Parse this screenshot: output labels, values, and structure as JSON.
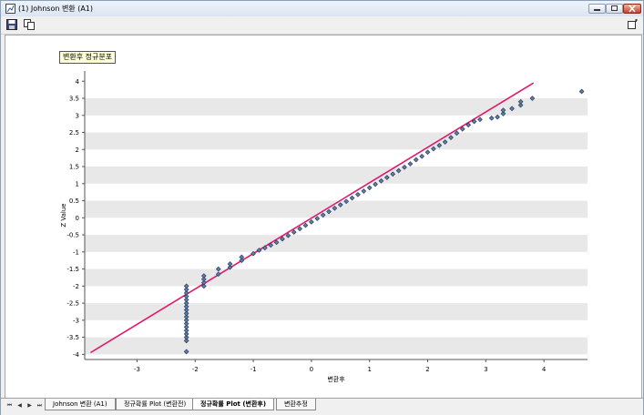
{
  "window": {
    "title": "(1) Johnson 변환 (A1)"
  },
  "toolbar": {
    "save_icon": "save-icon",
    "copy_icon": "copy-icon",
    "options_icon": "options-icon"
  },
  "chart_data": {
    "type": "scatter",
    "title": "변환후 정규분포",
    "xlabel": "변환후",
    "ylabel": "Z Value",
    "xlim": [
      -3.9,
      4.75
    ],
    "ylim": [
      -4.15,
      4.3
    ],
    "x_ticks": [
      -3,
      -2,
      -1,
      0,
      1,
      2,
      3,
      4
    ],
    "y_ticks": [
      4,
      3.5,
      3,
      2.5,
      2,
      1.5,
      1,
      0.5,
      0,
      -0.5,
      -1,
      -1.5,
      -2,
      -2.5,
      -3,
      -3.5,
      -4
    ],
    "grid": "alternating horizontal bands",
    "point_color": "#5b7fb0",
    "line_color": "#e0186c",
    "fit_line": {
      "x": [
        -3.8,
        3.82
      ],
      "y": [
        -3.95,
        3.95
      ]
    },
    "points": [
      {
        "x": -2.15,
        "y": -3.92
      },
      {
        "x": -2.15,
        "y": -3.6
      },
      {
        "x": -2.15,
        "y": -3.5
      },
      {
        "x": -2.15,
        "y": -3.4
      },
      {
        "x": -2.15,
        "y": -3.3
      },
      {
        "x": -2.15,
        "y": -3.2
      },
      {
        "x": -2.15,
        "y": -3.1
      },
      {
        "x": -2.15,
        "y": -3.0
      },
      {
        "x": -2.15,
        "y": -2.9
      },
      {
        "x": -2.15,
        "y": -2.8
      },
      {
        "x": -2.15,
        "y": -2.7
      },
      {
        "x": -2.15,
        "y": -2.6
      },
      {
        "x": -2.15,
        "y": -2.5
      },
      {
        "x": -2.15,
        "y": -2.4
      },
      {
        "x": -2.15,
        "y": -2.3
      },
      {
        "x": -2.15,
        "y": -2.2
      },
      {
        "x": -2.15,
        "y": -2.1
      },
      {
        "x": -2.15,
        "y": -2.0
      },
      {
        "x": -1.85,
        "y": -2.0
      },
      {
        "x": -1.85,
        "y": -1.9
      },
      {
        "x": -1.85,
        "y": -1.8
      },
      {
        "x": -1.85,
        "y": -1.7
      },
      {
        "x": -1.6,
        "y": -1.65
      },
      {
        "x": -1.6,
        "y": -1.5
      },
      {
        "x": -1.4,
        "y": -1.45
      },
      {
        "x": -1.4,
        "y": -1.35
      },
      {
        "x": -1.2,
        "y": -1.25
      },
      {
        "x": -1.2,
        "y": -1.15
      },
      {
        "x": -1.0,
        "y": -1.05
      },
      {
        "x": -0.9,
        "y": -0.95
      },
      {
        "x": -0.8,
        "y": -0.88
      },
      {
        "x": -0.7,
        "y": -0.8
      },
      {
        "x": -0.6,
        "y": -0.72
      },
      {
        "x": -0.5,
        "y": -0.62
      },
      {
        "x": -0.4,
        "y": -0.52
      },
      {
        "x": -0.3,
        "y": -0.42
      },
      {
        "x": -0.2,
        "y": -0.32
      },
      {
        "x": -0.1,
        "y": -0.22
      },
      {
        "x": 0.0,
        "y": -0.12
      },
      {
        "x": 0.1,
        "y": -0.02
      },
      {
        "x": 0.2,
        "y": 0.08
      },
      {
        "x": 0.3,
        "y": 0.18
      },
      {
        "x": 0.4,
        "y": 0.28
      },
      {
        "x": 0.5,
        "y": 0.38
      },
      {
        "x": 0.6,
        "y": 0.48
      },
      {
        "x": 0.7,
        "y": 0.58
      },
      {
        "x": 0.8,
        "y": 0.68
      },
      {
        "x": 0.9,
        "y": 0.78
      },
      {
        "x": 1.0,
        "y": 0.88
      },
      {
        "x": 1.1,
        "y": 0.98
      },
      {
        "x": 1.2,
        "y": 1.08
      },
      {
        "x": 1.3,
        "y": 1.18
      },
      {
        "x": 1.4,
        "y": 1.28
      },
      {
        "x": 1.5,
        "y": 1.38
      },
      {
        "x": 1.6,
        "y": 1.48
      },
      {
        "x": 1.7,
        "y": 1.58
      },
      {
        "x": 1.8,
        "y": 1.7
      },
      {
        "x": 1.9,
        "y": 1.8
      },
      {
        "x": 2.0,
        "y": 1.92
      },
      {
        "x": 2.1,
        "y": 2.02
      },
      {
        "x": 2.2,
        "y": 2.12
      },
      {
        "x": 2.3,
        "y": 2.22
      },
      {
        "x": 2.4,
        "y": 2.35
      },
      {
        "x": 2.5,
        "y": 2.48
      },
      {
        "x": 2.6,
        "y": 2.6
      },
      {
        "x": 2.7,
        "y": 2.72
      },
      {
        "x": 2.8,
        "y": 2.82
      },
      {
        "x": 2.9,
        "y": 2.88
      },
      {
        "x": 3.1,
        "y": 2.92
      },
      {
        "x": 3.2,
        "y": 2.95
      },
      {
        "x": 3.3,
        "y": 3.05
      },
      {
        "x": 3.3,
        "y": 3.15
      },
      {
        "x": 3.45,
        "y": 3.2
      },
      {
        "x": 3.6,
        "y": 3.3
      },
      {
        "x": 3.6,
        "y": 3.4
      },
      {
        "x": 3.8,
        "y": 3.5
      },
      {
        "x": 4.65,
        "y": 3.7
      }
    ]
  },
  "tabs": [
    {
      "label": "Johnson 변환 (A1)",
      "active": false
    },
    {
      "label": "정규확률 Plot (변환전)",
      "active": false
    },
    {
      "label": "정규확률 Plot (변환후)",
      "active": true
    },
    {
      "label": "변환추정",
      "active": false
    }
  ],
  "nav": {
    "first": "⏮",
    "prev": "◀",
    "next": "▶",
    "last": "⏭"
  }
}
